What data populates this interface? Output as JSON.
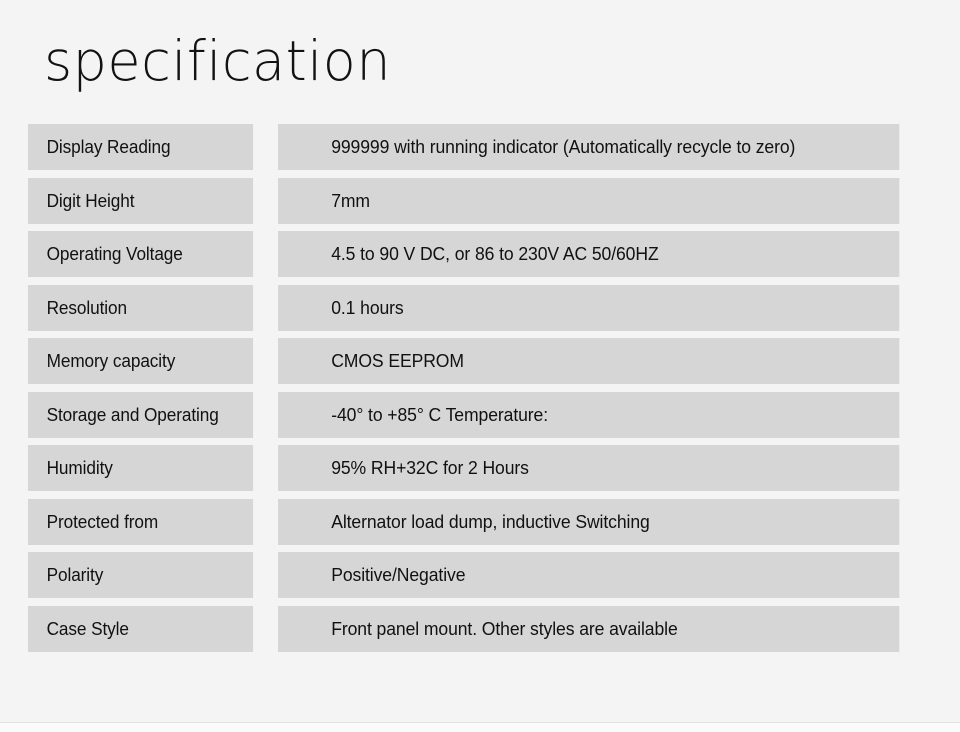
{
  "page": {
    "title": "specification",
    "background_color": "#f4f4f4",
    "row_fill_color": "#d6d6d6",
    "text_color": "#111111"
  },
  "spec_table": {
    "rows": [
      {
        "label": "Display Reading",
        "value": "999999 with running indicator (Automatically recycle to zero)"
      },
      {
        "label": "Digit Height",
        "value": "7mm"
      },
      {
        "label": "Operating Voltage",
        "value": "4.5 to 90 V DC, or 86 to 230V AC 50/60HZ"
      },
      {
        "label": "Resolution",
        "value": "0.1 hours"
      },
      {
        "label": "Memory capacity",
        "value": "CMOS EEPROM"
      },
      {
        "label": "Storage and Operating",
        "value": "-40° to +85° C Temperature:"
      },
      {
        "label": "Humidity",
        "value": "95% RH+32C for 2 Hours"
      },
      {
        "label": "Protected from",
        "value": "Alternator load dump, inductive Switching"
      },
      {
        "label": "Polarity",
        "value": "Positive/Negative"
      },
      {
        "label": "Case Style",
        "value": "Front panel mount. Other styles are available"
      }
    ]
  }
}
